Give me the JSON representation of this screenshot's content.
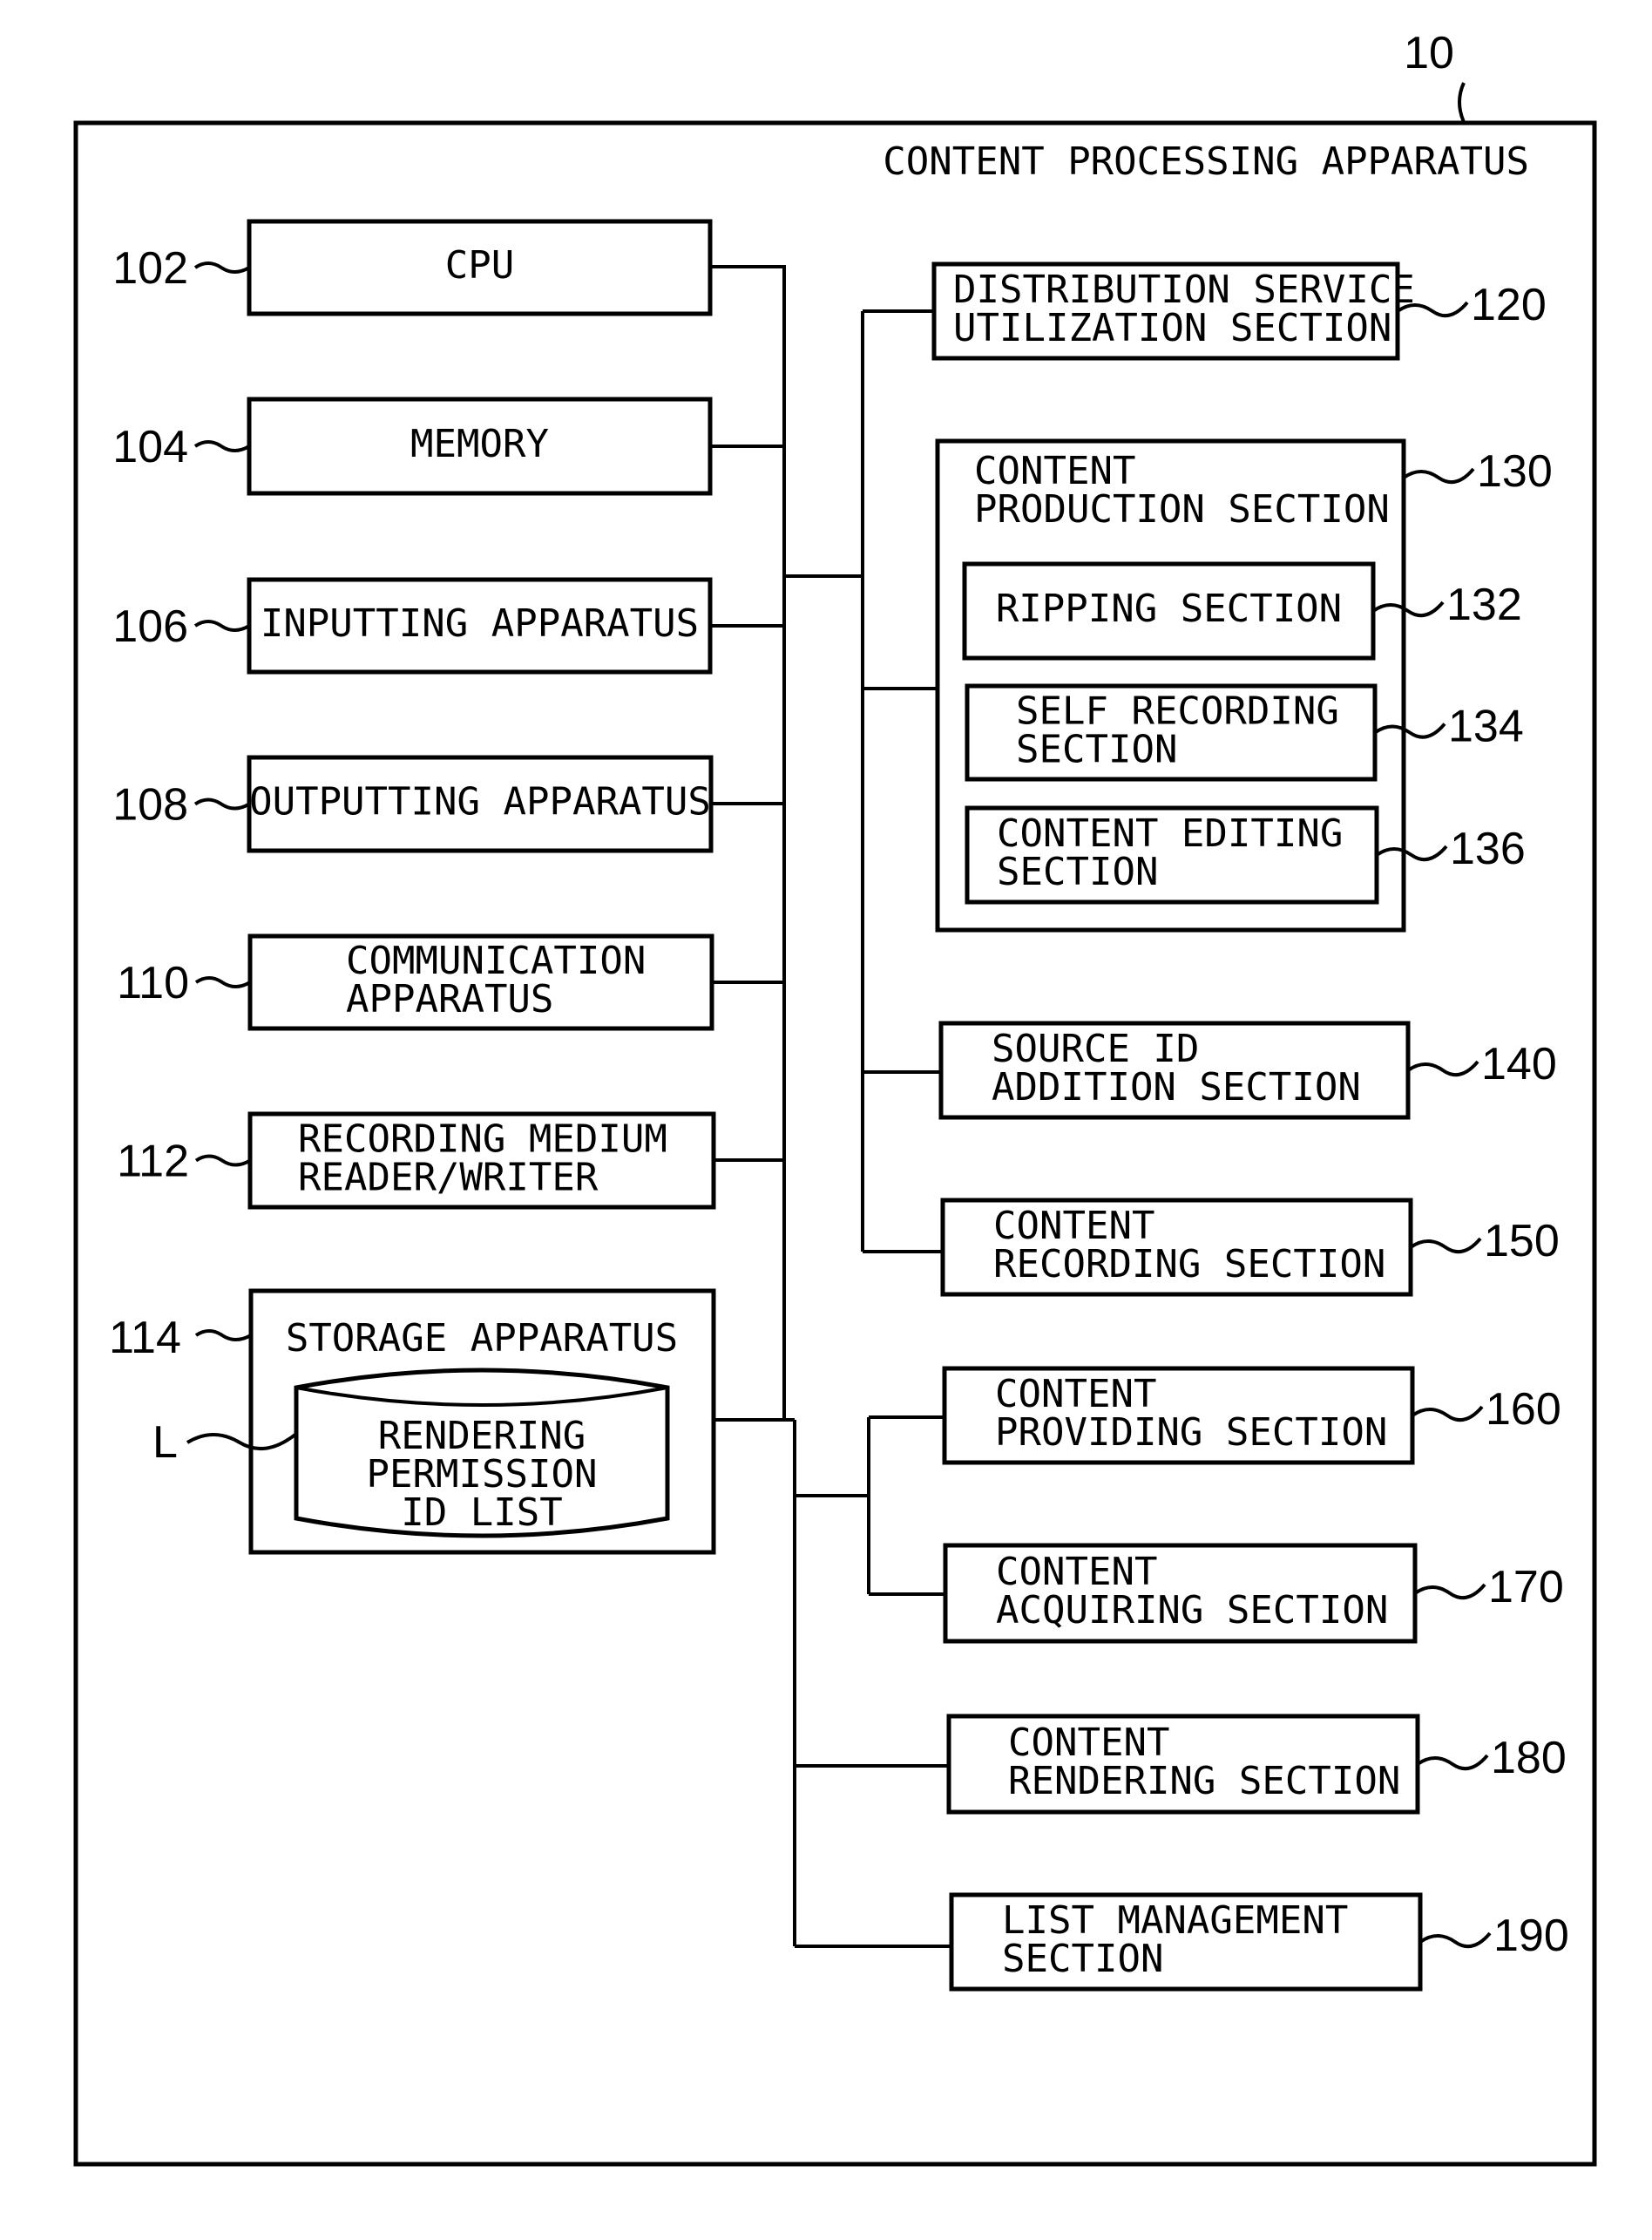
{
  "figure": {
    "ref": "10",
    "title": "CONTENT PROCESSING APPARATUS"
  },
  "left_blocks": [
    {
      "ref": "102",
      "lines": [
        "CPU"
      ]
    },
    {
      "ref": "104",
      "lines": [
        "MEMORY"
      ]
    },
    {
      "ref": "106",
      "lines": [
        "INPUTTING APPARATUS"
      ]
    },
    {
      "ref": "108",
      "lines": [
        "OUTPUTTING APPARATUS"
      ]
    },
    {
      "ref": "110",
      "lines": [
        "COMMUNICATION",
        "APPARATUS"
      ]
    },
    {
      "ref": "112",
      "lines": [
        "RECORDING MEDIUM",
        "READER/WRITER"
      ]
    }
  ],
  "storage": {
    "ref": "114",
    "title": "STORAGE APPARATUS",
    "db": {
      "ref": "L",
      "lines": [
        "RENDERING",
        "PERMISSION",
        "ID LIST"
      ]
    }
  },
  "right_blocks": [
    {
      "ref": "120",
      "lines": [
        "DISTRIBUTION SERVICE",
        "UTILIZATION SECTION"
      ]
    },
    {
      "ref": "130",
      "lines": [
        "CONTENT",
        "PRODUCTION SECTION"
      ],
      "children": [
        {
          "ref": "132",
          "lines": [
            "RIPPING SECTION"
          ]
        },
        {
          "ref": "134",
          "lines": [
            "SELF RECORDING",
            "SECTION"
          ]
        },
        {
          "ref": "136",
          "lines": [
            "CONTENT EDITING",
            "SECTION"
          ]
        }
      ]
    },
    {
      "ref": "140",
      "lines": [
        "SOURCE ID",
        "ADDITION SECTION"
      ]
    },
    {
      "ref": "150",
      "lines": [
        "CONTENT",
        "RECORDING SECTION"
      ]
    },
    {
      "ref": "160",
      "lines": [
        "CONTENT",
        "PROVIDING SECTION"
      ]
    },
    {
      "ref": "170",
      "lines": [
        "CONTENT",
        "ACQUIRING SECTION"
      ]
    },
    {
      "ref": "180",
      "lines": [
        "CONTENT",
        "RENDERING SECTION"
      ]
    },
    {
      "ref": "190",
      "lines": [
        "LIST MANAGEMENT",
        "SECTION"
      ]
    }
  ]
}
